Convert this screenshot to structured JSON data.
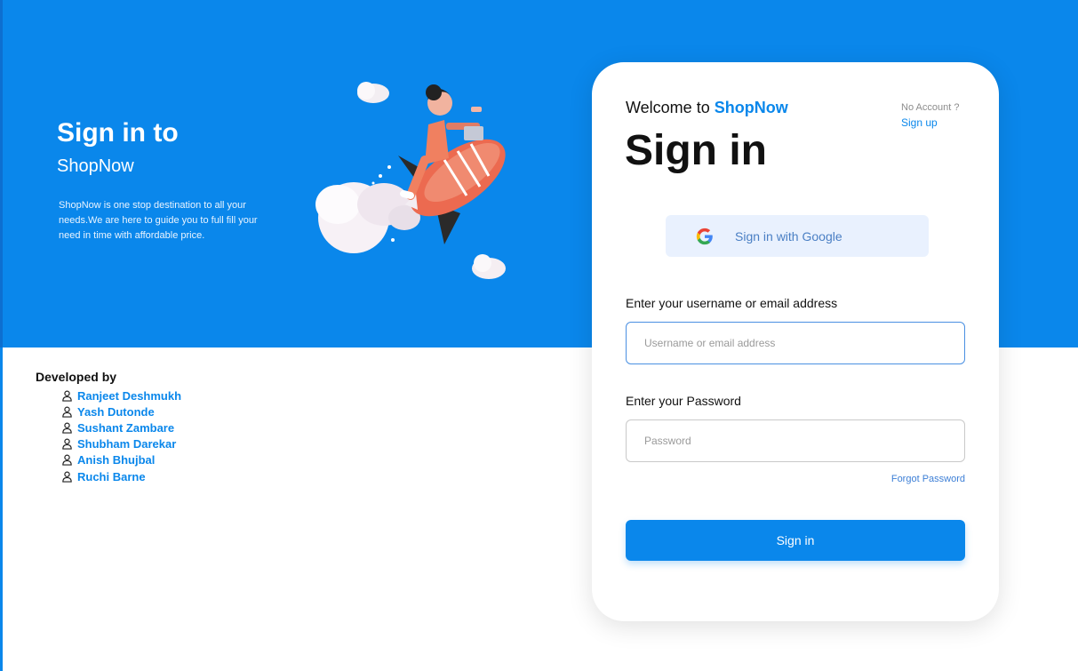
{
  "hero": {
    "title": "Sign in to",
    "subtitle": "ShopNow",
    "description": "ShopNow is one stop destination to all your needs.We are here to guide you to full fill your need in time with affordable price."
  },
  "developers": {
    "title": "Developed by",
    "names": [
      "Ranjeet Deshmukh",
      "Yash Dutonde",
      "Sushant Zambare",
      "Shubham Darekar",
      "Anish Bhujbal",
      "Ruchi Barne"
    ]
  },
  "card": {
    "welcome_prefix": "Welcome to ",
    "brand": "ShopNow",
    "no_account": "No Account ?",
    "signup": "Sign up",
    "title": "Sign in",
    "google_label": "Sign in with Google",
    "username_label": "Enter your username or email address",
    "username_placeholder": "Username or email address",
    "username_value": "",
    "password_label": "Enter your Password",
    "password_placeholder": "Password",
    "password_value": "",
    "forgot": "Forgot Password",
    "submit": "Sign in"
  },
  "colors": {
    "primary": "#0A87EB",
    "google_bg": "#E9F1FE",
    "link": "#3d7fd6"
  },
  "icons": {
    "google": "google-logo",
    "person": "person-outline",
    "illustration": "rocket-rider-with-clouds"
  }
}
